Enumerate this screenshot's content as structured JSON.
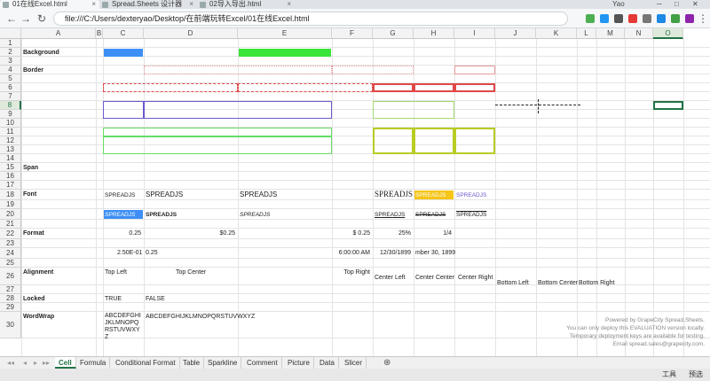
{
  "browser": {
    "tabs": [
      {
        "label": "01在线Excel.html",
        "active": true
      },
      {
        "label": "Spread.Sheets 设计器",
        "active": false
      },
      {
        "label": "02导入导出.html",
        "active": false
      }
    ],
    "user": "Yao",
    "url": "file:///C:/Users/dexteryao/Desktop/在前端玩转Excel/01在线Excel.html"
  },
  "sheet": {
    "columns": [
      "A",
      "B",
      "C",
      "D",
      "E",
      "F",
      "G",
      "H",
      "I",
      "J",
      "K",
      "L",
      "M",
      "N",
      "O"
    ],
    "rows": [
      "1",
      "2",
      "3",
      "4",
      "5",
      "6",
      "7",
      "8",
      "9",
      "10",
      "11",
      "12",
      "13",
      "14",
      "15",
      "16",
      "17",
      "18",
      "19",
      "20",
      "21",
      "22",
      "23",
      "24",
      "25",
      "26",
      "27",
      "28",
      "29",
      "30"
    ],
    "selected_cell": "O8",
    "labels": {
      "background": "Background",
      "border": "Border",
      "span": "Span",
      "font": "Font",
      "format": "Format",
      "alignment": "Alignment",
      "locked": "Locked",
      "wordwrap": "WordWrap"
    },
    "font_samples": {
      "c18": "SPREADJS",
      "d18": "SPREADJS",
      "e18": "SPREADJS",
      "f18": "SPREADJS",
      "g18": "SPREADJS",
      "h18": "SPREADJS",
      "c20": "SPREADJS",
      "d20": "SPREADJS",
      "e20": "SPREADJS",
      "f20": "SPREADJS",
      "g20": "SPREADJS",
      "h20": "SPREADJS"
    },
    "format_samples": {
      "c22": "0.25",
      "d22": "$0.25",
      "e22": "$ 0.25",
      "f22": "25%",
      "g22": "1/4",
      "c24": "2.50E-01",
      "d24": "0.25",
      "e24": "6:00:00 AM",
      "f24": "12/30/1899",
      "g24": "mber 30, 1899"
    },
    "alignment_samples": {
      "top_left": "Top Left",
      "top_center": "Top Center",
      "top_right": "Top Right",
      "center_left": "Center Left",
      "center_center": "Center Center",
      "center_right": "Center Right",
      "bottom_left": "Bottom Left",
      "bottom_center": "Bottom Center",
      "bottom_right": "Bottom Right"
    },
    "locked_samples": {
      "c28": "TRUE",
      "d28": "FALSE"
    },
    "wordwrap_samples": {
      "c30": "ABCDEFGHIJKLMNOPQRSTUVWXYZ",
      "d30": "ABCDEFGHIJKLMNOPQRSTUVWXYZ"
    },
    "watermark": [
      "Powered by GrapeCity Spread.Sheets.",
      "You can only deploy this EVALUATION version locally.",
      "Temporary deployment keys are available for testing.",
      "Email spread.sales@grapecity.com."
    ]
  },
  "sheet_tabs": [
    "Cell",
    "Formula",
    "Conditional Format",
    "Table",
    "Sparkline",
    "Comment",
    "Picture",
    "Data",
    "Slicer"
  ],
  "active_sheet_tab": "Cell",
  "taskbar": {
    "tools": "工具",
    "preview": "预选"
  },
  "colors": {
    "blue_fill": "#3d8ff5",
    "green_fill": "#38e53a",
    "gold_fill": "#f5c518",
    "accent": "#217346"
  }
}
